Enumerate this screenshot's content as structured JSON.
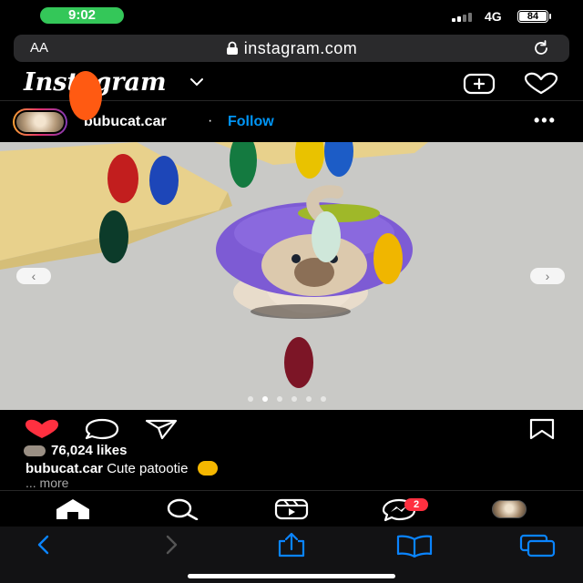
{
  "status_bar": {
    "time": "9:02",
    "network": "4G",
    "battery": "84"
  },
  "browser": {
    "text_size_label": "AA",
    "url": "instagram.com",
    "reload_icon": "reload-icon"
  },
  "instagram_header": {
    "logo": "Instagram",
    "chevron": "⌄",
    "icons": [
      "new-post-icon",
      "activity-heart-icon"
    ]
  },
  "post": {
    "username": "bubucat.car",
    "separator": "·",
    "follow_label": "Follow",
    "more_label": "•••",
    "carousel_count": 6,
    "carousel_active_index": 1,
    "likes": "76,024 likes",
    "caption_user": "bubucat.car",
    "caption_text": "Cute patootie",
    "caption_emoji": "😍",
    "more_link": "... more"
  },
  "bottom_nav": {
    "items": [
      "home-icon",
      "search-icon",
      "reels-icon",
      "messenger-icon",
      "profile-avatar"
    ],
    "messages_badge": "2"
  },
  "safari_toolbar": {
    "items": [
      "back-icon",
      "forward-icon",
      "share-icon",
      "bookmarks-icon",
      "tabs-icon"
    ]
  },
  "colors": {
    "accent_blue": "#0095f6",
    "like_red": "#ff3040",
    "safari_blue": "#0a84ff",
    "time_green": "#34c759"
  }
}
